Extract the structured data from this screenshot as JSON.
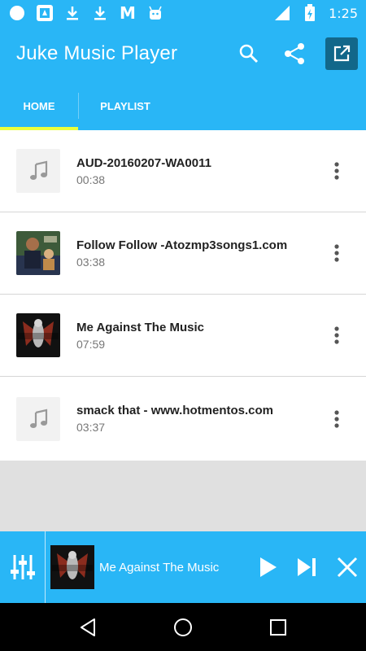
{
  "status_bar": {
    "time": "1:25",
    "icons": [
      "circle-icon",
      "app-notification-icon",
      "download-icon",
      "download-icon",
      "m-app-icon",
      "android-icon",
      "wifi-icon",
      "battery-charging-icon"
    ]
  },
  "app_bar": {
    "title": "Juke Music Player",
    "actions": [
      "search-icon",
      "share-icon",
      "open-external-icon"
    ]
  },
  "tabs": [
    {
      "label": "HOME",
      "active": true
    },
    {
      "label": "PLAYLIST",
      "active": false
    }
  ],
  "songs": [
    {
      "title": "AUD-20160207-WA0011",
      "duration": "00:38",
      "art": "music-note-icon"
    },
    {
      "title": "Follow Follow -Atozmp3songs1.com",
      "duration": "03:38",
      "art": "album-art"
    },
    {
      "title": "Me Against The Music",
      "duration": "07:59",
      "art": "album-art"
    },
    {
      "title": "smack that - www.hotmentos.com",
      "duration": "03:37",
      "art": "music-note-icon"
    }
  ],
  "player": {
    "now_playing": "Me Against The Music",
    "controls": [
      "equalizer-icon",
      "play-icon",
      "skip-next-icon",
      "close-icon"
    ]
  },
  "colors": {
    "primary": "#29b6f6",
    "accent_indicator": "#eaff3c",
    "action_dark": "#12678a"
  },
  "nav": [
    "back-icon",
    "home-icon",
    "recents-icon"
  ]
}
